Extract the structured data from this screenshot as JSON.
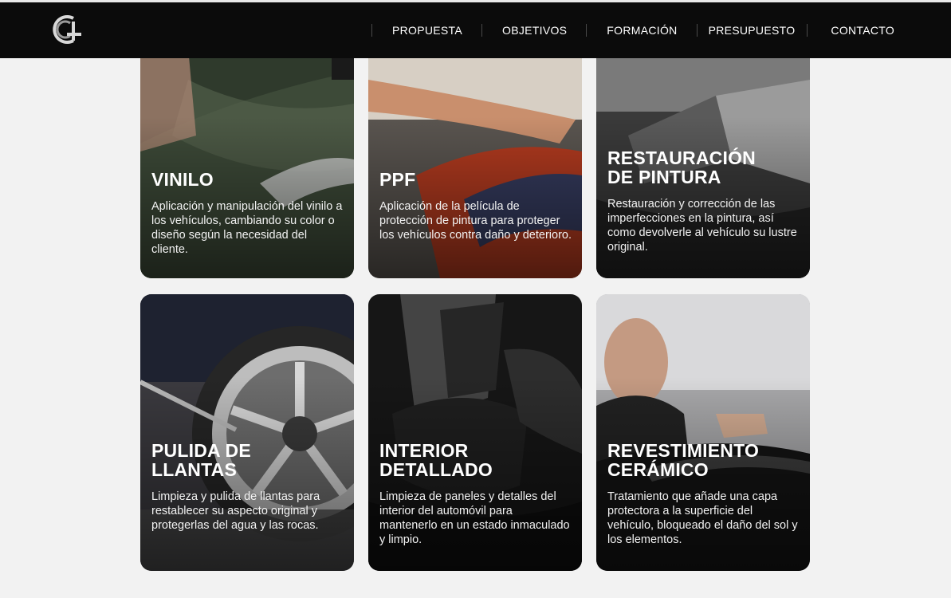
{
  "nav": {
    "logo_alt": "logo",
    "items": [
      {
        "label": "PROPUESTA"
      },
      {
        "label": "OBJETIVOS"
      },
      {
        "label": "FORMACIÓN"
      },
      {
        "label": "PRESUPUESTO"
      },
      {
        "label": "CONTACTO"
      }
    ]
  },
  "cards": [
    {
      "title": "VINILO",
      "text": "Aplicación y manipulación del vinilo a los vehículos, cambiando su color o diseño según la necesidad del cliente."
    },
    {
      "title": "PPF",
      "text": "Aplicación de la película de protección de pintura para proteger los vehículos contra daño y deterioro."
    },
    {
      "title": "RESTAURACIÓN\nDE PINTURA",
      "text": "Restauración y corrección de las imperfecciones en la pintura, así como devolverle al vehículo su lustre original."
    },
    {
      "title": "PULIDA DE\nLLANTAS",
      "text": "Limpieza y pulida de llantas para restablecer su aspecto original y protegerlas del agua y las rocas."
    },
    {
      "title": "INTERIOR\nDETALLADO",
      "text": "Limpieza de paneles y detalles del interior del automóvil para mantenerlo en un estado inmaculado y limpio."
    },
    {
      "title": "REVESTIMIENTO\nCERÁMICO",
      "text": "Tratamiento que añade una capa protectora a la superficie del vehículo, bloqueado el daño del sol y los elementos."
    }
  ]
}
